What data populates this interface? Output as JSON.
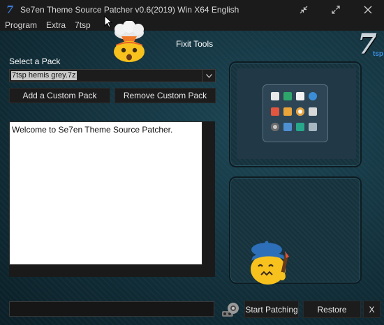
{
  "window": {
    "title": "Se7en Theme Source Patcher v0.6(2019) Win X64 English",
    "app_icon_glyph": "7",
    "controls": {
      "minimize_icon": "collapse-arrows-icon",
      "maximize_icon": "expand-arrows-icon",
      "close_icon": "close-icon"
    }
  },
  "menu": {
    "items": [
      "Program",
      "Extra",
      "7tsp"
    ]
  },
  "header": {
    "fixit_label": "Fixit Tools",
    "logo": {
      "main": "7",
      "sub": "tsp"
    }
  },
  "pack": {
    "label": "Select a Pack",
    "selected": "7tsp hemis grey.7z",
    "add_button": "Add a Custom Pack",
    "remove_button": "Remove Custom Pack"
  },
  "log": {
    "text": "Welcome to Se7en Theme Source Patcher."
  },
  "footer": {
    "status_value": "",
    "start_button": "Start Patching",
    "restore_button": "Restore",
    "close_button": "X"
  },
  "colors": {
    "accent": "#3b8de0",
    "background": "#12303b",
    "button": "#1c1c1c"
  },
  "decorations": [
    "exploding-head-emoji",
    "artist-emoji",
    "preview-icons"
  ]
}
